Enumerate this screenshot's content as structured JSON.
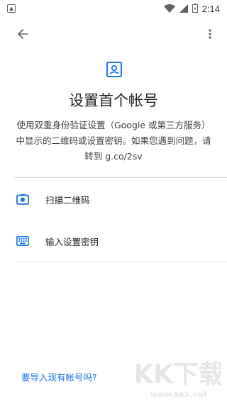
{
  "status_bar": {
    "time": "2:14",
    "icons": [
      "notification-icon",
      "wifi-icon",
      "signal-icon",
      "battery-icon"
    ]
  },
  "app_bar": {
    "back_icon": "arrow-back-icon",
    "more_icon": "more-vert-icon"
  },
  "hero_icon": "account-box-icon",
  "title": "设置首个帐号",
  "description": {
    "line1": "使用双重身份验证设置（Google 或第三方服务）",
    "line2": "中显示的二维码或设置密钥。如果您遇到问题，请",
    "line3": "转到 g.co/2sv"
  },
  "options": [
    {
      "label": "扫描二维码",
      "icon": "camera-icon"
    },
    {
      "label": "输入设置密钥",
      "icon": "keyboard-icon"
    }
  ],
  "import_link": "要导入现有帐号吗?",
  "colors": {
    "accent": "#1a73e8",
    "icon_gray": "#5f6368",
    "divider": "#dadce0"
  },
  "watermark": {
    "main": "KK下载",
    "sub": "www.kkx.net"
  }
}
